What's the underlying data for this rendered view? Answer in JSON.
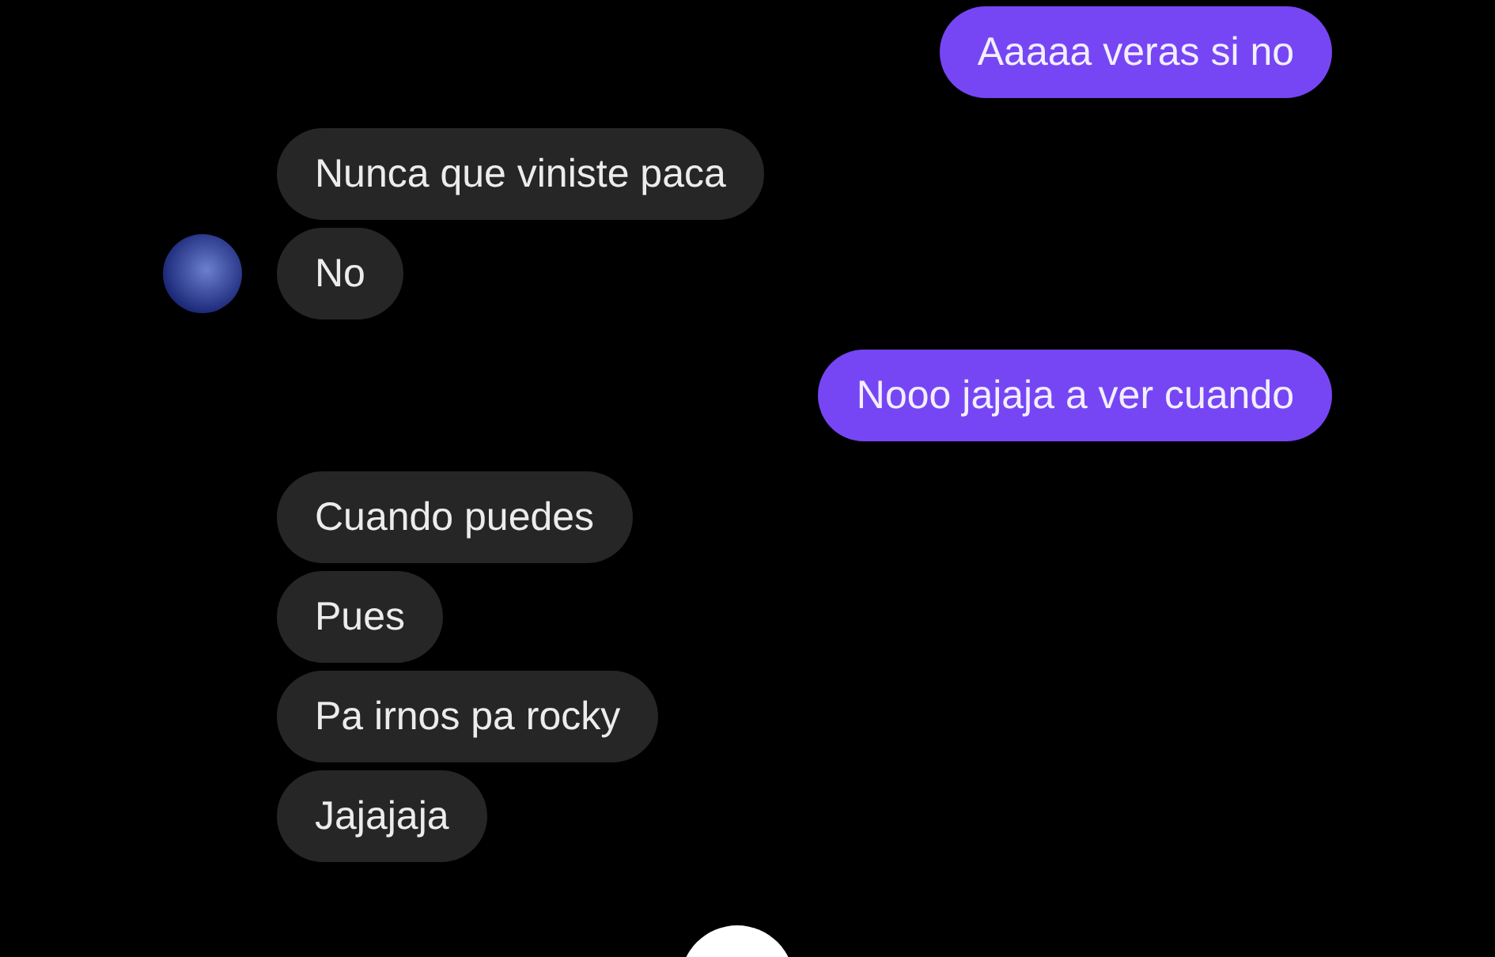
{
  "messages": [
    {
      "kind": "sent",
      "text": "Aaaaa veras si no",
      "avatar": false
    },
    {
      "kind": "received",
      "text": "Nunca que viniste paca",
      "avatar": false
    },
    {
      "kind": "received",
      "text": "No",
      "avatar": true
    },
    {
      "kind": "sent",
      "text": "Nooo jajaja a ver cuando",
      "avatar": false
    },
    {
      "kind": "received",
      "text": "Cuando puedes",
      "avatar": false
    },
    {
      "kind": "received",
      "text": "Pues",
      "avatar": false
    },
    {
      "kind": "received",
      "text": "Pa irnos pa rocky",
      "avatar": false
    },
    {
      "kind": "received",
      "text": "Jajajaja",
      "avatar": false
    }
  ]
}
